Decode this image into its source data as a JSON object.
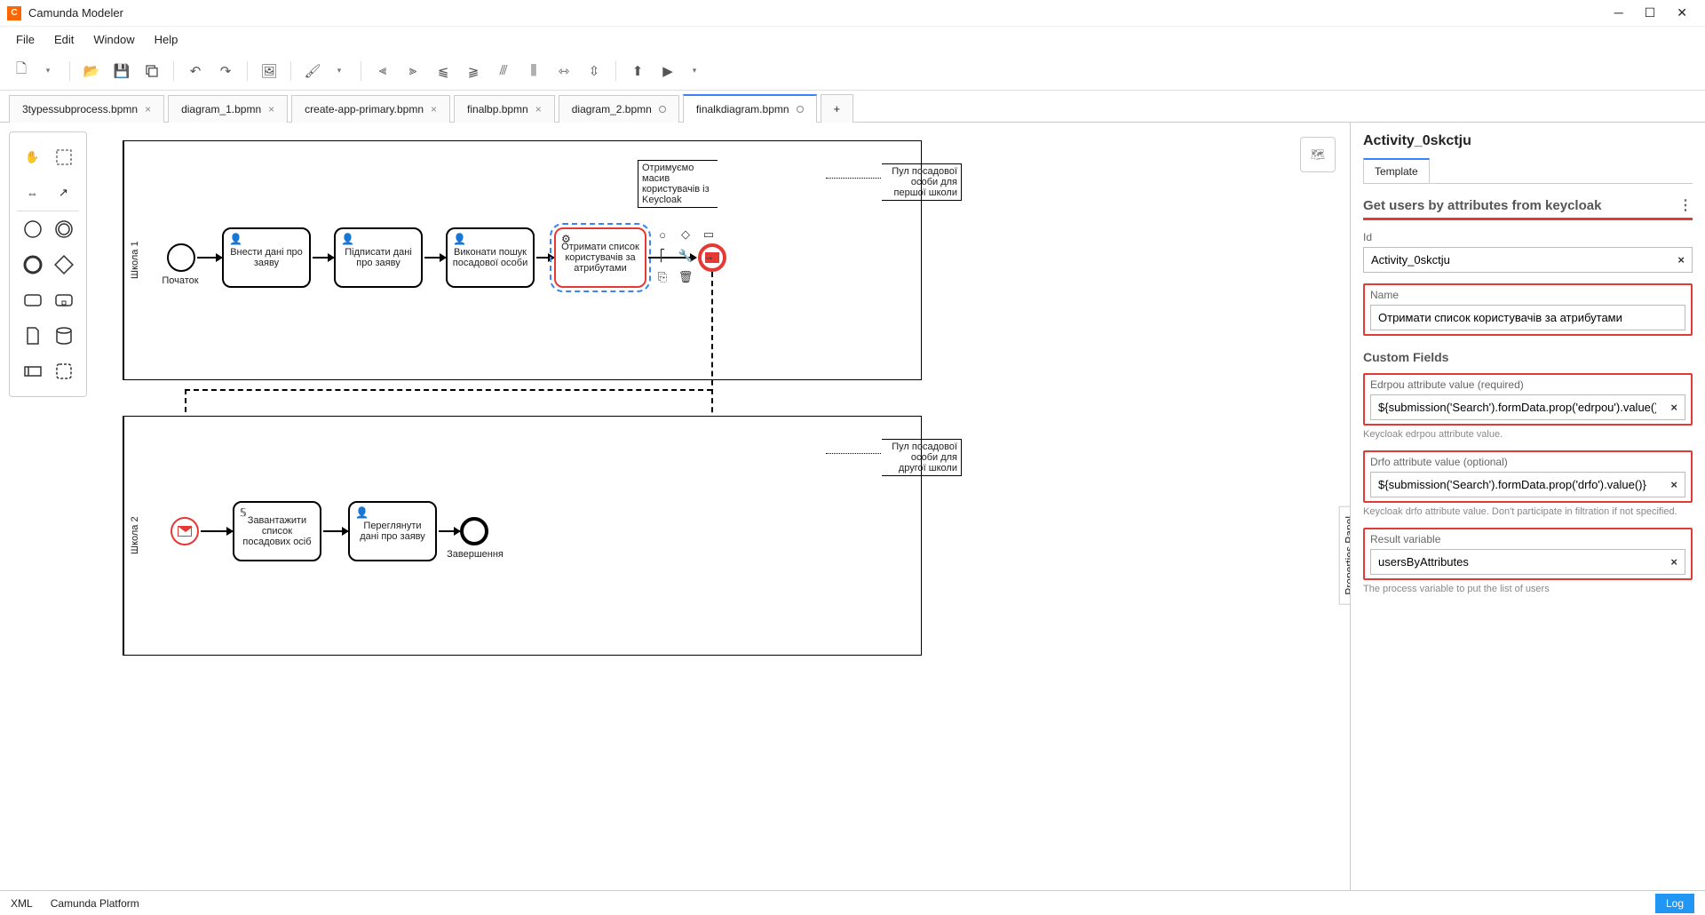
{
  "app": {
    "title": "Camunda Modeler"
  },
  "menu": {
    "file": "File",
    "edit": "Edit",
    "window": "Window",
    "help": "Help"
  },
  "tabs": [
    {
      "label": "3typessubprocess.bpmn",
      "closable": true
    },
    {
      "label": "diagram_1.bpmn",
      "closable": true
    },
    {
      "label": "create-app-primary.bpmn",
      "closable": true
    },
    {
      "label": "finalbp.bpmn",
      "closable": true
    },
    {
      "label": "diagram_2.bpmn",
      "dirty": true
    },
    {
      "label": "finalkdiagram.bpmn",
      "dirty": true,
      "active": true
    }
  ],
  "canvas": {
    "pool1_label": "Школа 1",
    "pool2_label": "Школа 2",
    "start1": "Початок",
    "task1": "Внести дані про заяву",
    "task2": "Підписати дані про заяву",
    "task3": "Виконати пошук посадової особи",
    "task4": "Отримати список користувачів за атрибутами",
    "annotation1": "Отримуємо масив користувачів із Keycloak",
    "annotation2": "Пул посадової особи для першої школи",
    "annotation3": "Пул посадової особи для другої школи",
    "task5": "Завантажити список посадових осіб",
    "task6": "Переглянути дані про заяву",
    "end2": "Завершення"
  },
  "props": {
    "title": "Activity_0skctju",
    "tab_template": "Template",
    "section_title": "Get users by attributes from keycloak",
    "id_label": "Id",
    "id_value": "Activity_0skctju",
    "name_label": "Name",
    "name_value": "Отримати список користувачів за атрибутами",
    "custom_fields": "Custom Fields",
    "edrpou_label": "Edrpou attribute value (required)",
    "edrpou_value": "${submission('Search').formData.prop('edrpou').value()}",
    "edrpou_hint": "Keycloak edrpou attribute value.",
    "drfo_label": "Drfo attribute value (optional)",
    "drfo_value": "${submission('Search').formData.prop('drfo').value()}",
    "drfo_hint": "Keycloak drfo attribute value. Don't participate in filtration if not specified.",
    "result_label": "Result variable",
    "result_value": "usersByAttributes",
    "result_hint": "The process variable to put the list of users"
  },
  "status": {
    "xml": "XML",
    "platform": "Camunda Platform",
    "log": "Log"
  },
  "side_label": "Properties Panel"
}
